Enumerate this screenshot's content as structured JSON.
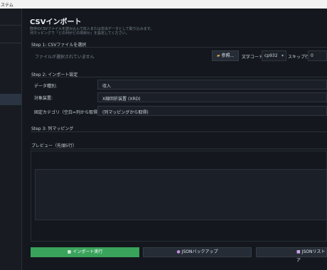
{
  "titlebar": {
    "title": "ステム"
  },
  "header": {
    "title": "CSVインポート",
    "desc_line1": "既存のCSVファイルを読み込んで収入または支出データとして取り込みます。",
    "desc_line2": "列マッピングで「どの列がどの項目か」を設定してください。"
  },
  "step1": {
    "label": "Step 1: CSVファイルを選択",
    "file_placeholder": "ファイルが選択されていません",
    "browse_label": "参照...",
    "encoding_label": "文字コード:",
    "encoding_value": "cp932",
    "skip_label": "スキップ行:",
    "skip_value": "0"
  },
  "step2": {
    "label": "Step 2: インポート設定",
    "type_label": "データ種別:",
    "type_value": "収入",
    "device_label": "対象装置:",
    "device_value": "X線回折装置 (XRD)",
    "category_label": "固定カテゴリ（空白=列から取得）:",
    "category_value": "(列マッピングから取得)"
  },
  "step3": {
    "label": "Step 3: 列マッピング"
  },
  "preview": {
    "label": "プレビュー（先頭5行）"
  },
  "actions": {
    "import_label": "インポート実行",
    "json_backup_label": "JSONバックアップ",
    "json_restore_label": "JSONリストア"
  },
  "colors": {
    "accent": "#3aa35b",
    "background": "#14181e"
  },
  "icons": {
    "browse": "folder-icon",
    "backup": "person-icon",
    "restore": "save-icon",
    "import": "grid-icon"
  }
}
